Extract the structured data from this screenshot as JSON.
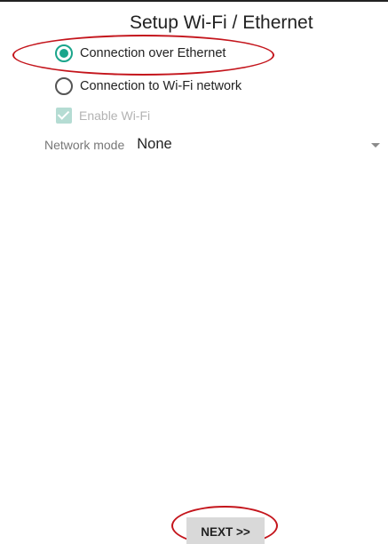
{
  "header": {
    "title": "Setup Wi-Fi / Ethernet"
  },
  "connection_options": [
    {
      "label": "Connection over Ethernet",
      "selected": true
    },
    {
      "label": "Connection to Wi-Fi network",
      "selected": false
    }
  ],
  "enable_wifi": {
    "label": "Enable Wi-Fi",
    "checked": true,
    "enabled": false
  },
  "network_mode": {
    "label": "Network mode",
    "value": "None"
  },
  "footer": {
    "next_label": "NEXT >>"
  },
  "colors": {
    "accent": "#1aa58b",
    "highlight": "#c4151c"
  },
  "icons": {
    "dropdown": "chevron-down-icon",
    "checkbox": "check-icon"
  }
}
